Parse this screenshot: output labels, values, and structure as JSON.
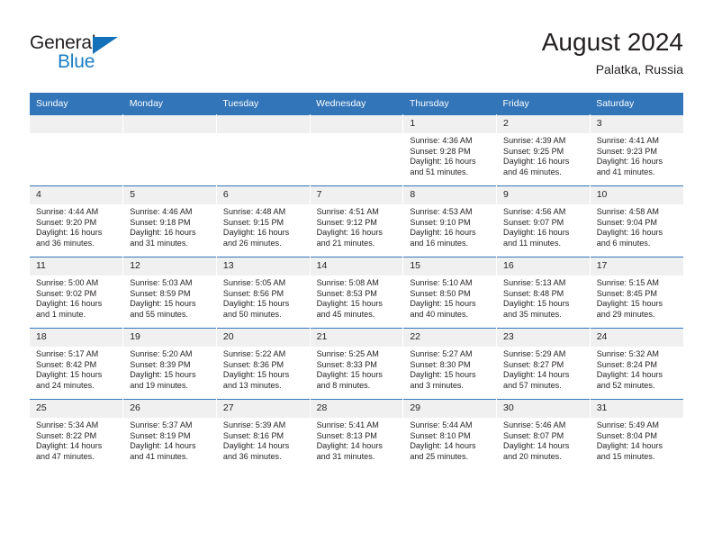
{
  "brand": {
    "name_part1": "General",
    "name_part2": "Blue",
    "accent_color": "#1a7dc4",
    "triangle_color": "#1271b8"
  },
  "header": {
    "title": "August 2024",
    "subtitle": "Palatka, Russia"
  },
  "theme": {
    "header_row_bg": "#3275b9",
    "daynum_bg": "#f0f0f0",
    "row_border": "#3275b9",
    "text": "#231f20"
  },
  "weekdays": [
    "Sunday",
    "Monday",
    "Tuesday",
    "Wednesday",
    "Thursday",
    "Friday",
    "Saturday"
  ],
  "labels": {
    "sunrise": "Sunrise:",
    "sunset": "Sunset:",
    "daylight": "Daylight:"
  },
  "weeks": [
    [
      {
        "day": "",
        "empty": true
      },
      {
        "day": "",
        "empty": true
      },
      {
        "day": "",
        "empty": true
      },
      {
        "day": "",
        "empty": true
      },
      {
        "day": "1",
        "sunrise": "Sunrise: 4:36 AM",
        "sunset": "Sunset: 9:28 PM",
        "daylight1": "Daylight: 16 hours",
        "daylight2": "and 51 minutes."
      },
      {
        "day": "2",
        "sunrise": "Sunrise: 4:39 AM",
        "sunset": "Sunset: 9:25 PM",
        "daylight1": "Daylight: 16 hours",
        "daylight2": "and 46 minutes."
      },
      {
        "day": "3",
        "sunrise": "Sunrise: 4:41 AM",
        "sunset": "Sunset: 9:23 PM",
        "daylight1": "Daylight: 16 hours",
        "daylight2": "and 41 minutes."
      }
    ],
    [
      {
        "day": "4",
        "sunrise": "Sunrise: 4:44 AM",
        "sunset": "Sunset: 9:20 PM",
        "daylight1": "Daylight: 16 hours",
        "daylight2": "and 36 minutes."
      },
      {
        "day": "5",
        "sunrise": "Sunrise: 4:46 AM",
        "sunset": "Sunset: 9:18 PM",
        "daylight1": "Daylight: 16 hours",
        "daylight2": "and 31 minutes."
      },
      {
        "day": "6",
        "sunrise": "Sunrise: 4:48 AM",
        "sunset": "Sunset: 9:15 PM",
        "daylight1": "Daylight: 16 hours",
        "daylight2": "and 26 minutes."
      },
      {
        "day": "7",
        "sunrise": "Sunrise: 4:51 AM",
        "sunset": "Sunset: 9:12 PM",
        "daylight1": "Daylight: 16 hours",
        "daylight2": "and 21 minutes."
      },
      {
        "day": "8",
        "sunrise": "Sunrise: 4:53 AM",
        "sunset": "Sunset: 9:10 PM",
        "daylight1": "Daylight: 16 hours",
        "daylight2": "and 16 minutes."
      },
      {
        "day": "9",
        "sunrise": "Sunrise: 4:56 AM",
        "sunset": "Sunset: 9:07 PM",
        "daylight1": "Daylight: 16 hours",
        "daylight2": "and 11 minutes."
      },
      {
        "day": "10",
        "sunrise": "Sunrise: 4:58 AM",
        "sunset": "Sunset: 9:04 PM",
        "daylight1": "Daylight: 16 hours",
        "daylight2": "and 6 minutes."
      }
    ],
    [
      {
        "day": "11",
        "sunrise": "Sunrise: 5:00 AM",
        "sunset": "Sunset: 9:02 PM",
        "daylight1": "Daylight: 16 hours",
        "daylight2": "and 1 minute."
      },
      {
        "day": "12",
        "sunrise": "Sunrise: 5:03 AM",
        "sunset": "Sunset: 8:59 PM",
        "daylight1": "Daylight: 15 hours",
        "daylight2": "and 55 minutes."
      },
      {
        "day": "13",
        "sunrise": "Sunrise: 5:05 AM",
        "sunset": "Sunset: 8:56 PM",
        "daylight1": "Daylight: 15 hours",
        "daylight2": "and 50 minutes."
      },
      {
        "day": "14",
        "sunrise": "Sunrise: 5:08 AM",
        "sunset": "Sunset: 8:53 PM",
        "daylight1": "Daylight: 15 hours",
        "daylight2": "and 45 minutes."
      },
      {
        "day": "15",
        "sunrise": "Sunrise: 5:10 AM",
        "sunset": "Sunset: 8:50 PM",
        "daylight1": "Daylight: 15 hours",
        "daylight2": "and 40 minutes."
      },
      {
        "day": "16",
        "sunrise": "Sunrise: 5:13 AM",
        "sunset": "Sunset: 8:48 PM",
        "daylight1": "Daylight: 15 hours",
        "daylight2": "and 35 minutes."
      },
      {
        "day": "17",
        "sunrise": "Sunrise: 5:15 AM",
        "sunset": "Sunset: 8:45 PM",
        "daylight1": "Daylight: 15 hours",
        "daylight2": "and 29 minutes."
      }
    ],
    [
      {
        "day": "18",
        "sunrise": "Sunrise: 5:17 AM",
        "sunset": "Sunset: 8:42 PM",
        "daylight1": "Daylight: 15 hours",
        "daylight2": "and 24 minutes."
      },
      {
        "day": "19",
        "sunrise": "Sunrise: 5:20 AM",
        "sunset": "Sunset: 8:39 PM",
        "daylight1": "Daylight: 15 hours",
        "daylight2": "and 19 minutes."
      },
      {
        "day": "20",
        "sunrise": "Sunrise: 5:22 AM",
        "sunset": "Sunset: 8:36 PM",
        "daylight1": "Daylight: 15 hours",
        "daylight2": "and 13 minutes."
      },
      {
        "day": "21",
        "sunrise": "Sunrise: 5:25 AM",
        "sunset": "Sunset: 8:33 PM",
        "daylight1": "Daylight: 15 hours",
        "daylight2": "and 8 minutes."
      },
      {
        "day": "22",
        "sunrise": "Sunrise: 5:27 AM",
        "sunset": "Sunset: 8:30 PM",
        "daylight1": "Daylight: 15 hours",
        "daylight2": "and 3 minutes."
      },
      {
        "day": "23",
        "sunrise": "Sunrise: 5:29 AM",
        "sunset": "Sunset: 8:27 PM",
        "daylight1": "Daylight: 14 hours",
        "daylight2": "and 57 minutes."
      },
      {
        "day": "24",
        "sunrise": "Sunrise: 5:32 AM",
        "sunset": "Sunset: 8:24 PM",
        "daylight1": "Daylight: 14 hours",
        "daylight2": "and 52 minutes."
      }
    ],
    [
      {
        "day": "25",
        "sunrise": "Sunrise: 5:34 AM",
        "sunset": "Sunset: 8:22 PM",
        "daylight1": "Daylight: 14 hours",
        "daylight2": "and 47 minutes."
      },
      {
        "day": "26",
        "sunrise": "Sunrise: 5:37 AM",
        "sunset": "Sunset: 8:19 PM",
        "daylight1": "Daylight: 14 hours",
        "daylight2": "and 41 minutes."
      },
      {
        "day": "27",
        "sunrise": "Sunrise: 5:39 AM",
        "sunset": "Sunset: 8:16 PM",
        "daylight1": "Daylight: 14 hours",
        "daylight2": "and 36 minutes."
      },
      {
        "day": "28",
        "sunrise": "Sunrise: 5:41 AM",
        "sunset": "Sunset: 8:13 PM",
        "daylight1": "Daylight: 14 hours",
        "daylight2": "and 31 minutes."
      },
      {
        "day": "29",
        "sunrise": "Sunrise: 5:44 AM",
        "sunset": "Sunset: 8:10 PM",
        "daylight1": "Daylight: 14 hours",
        "daylight2": "and 25 minutes."
      },
      {
        "day": "30",
        "sunrise": "Sunrise: 5:46 AM",
        "sunset": "Sunset: 8:07 PM",
        "daylight1": "Daylight: 14 hours",
        "daylight2": "and 20 minutes."
      },
      {
        "day": "31",
        "sunrise": "Sunrise: 5:49 AM",
        "sunset": "Sunset: 8:04 PM",
        "daylight1": "Daylight: 14 hours",
        "daylight2": "and 15 minutes."
      }
    ]
  ]
}
